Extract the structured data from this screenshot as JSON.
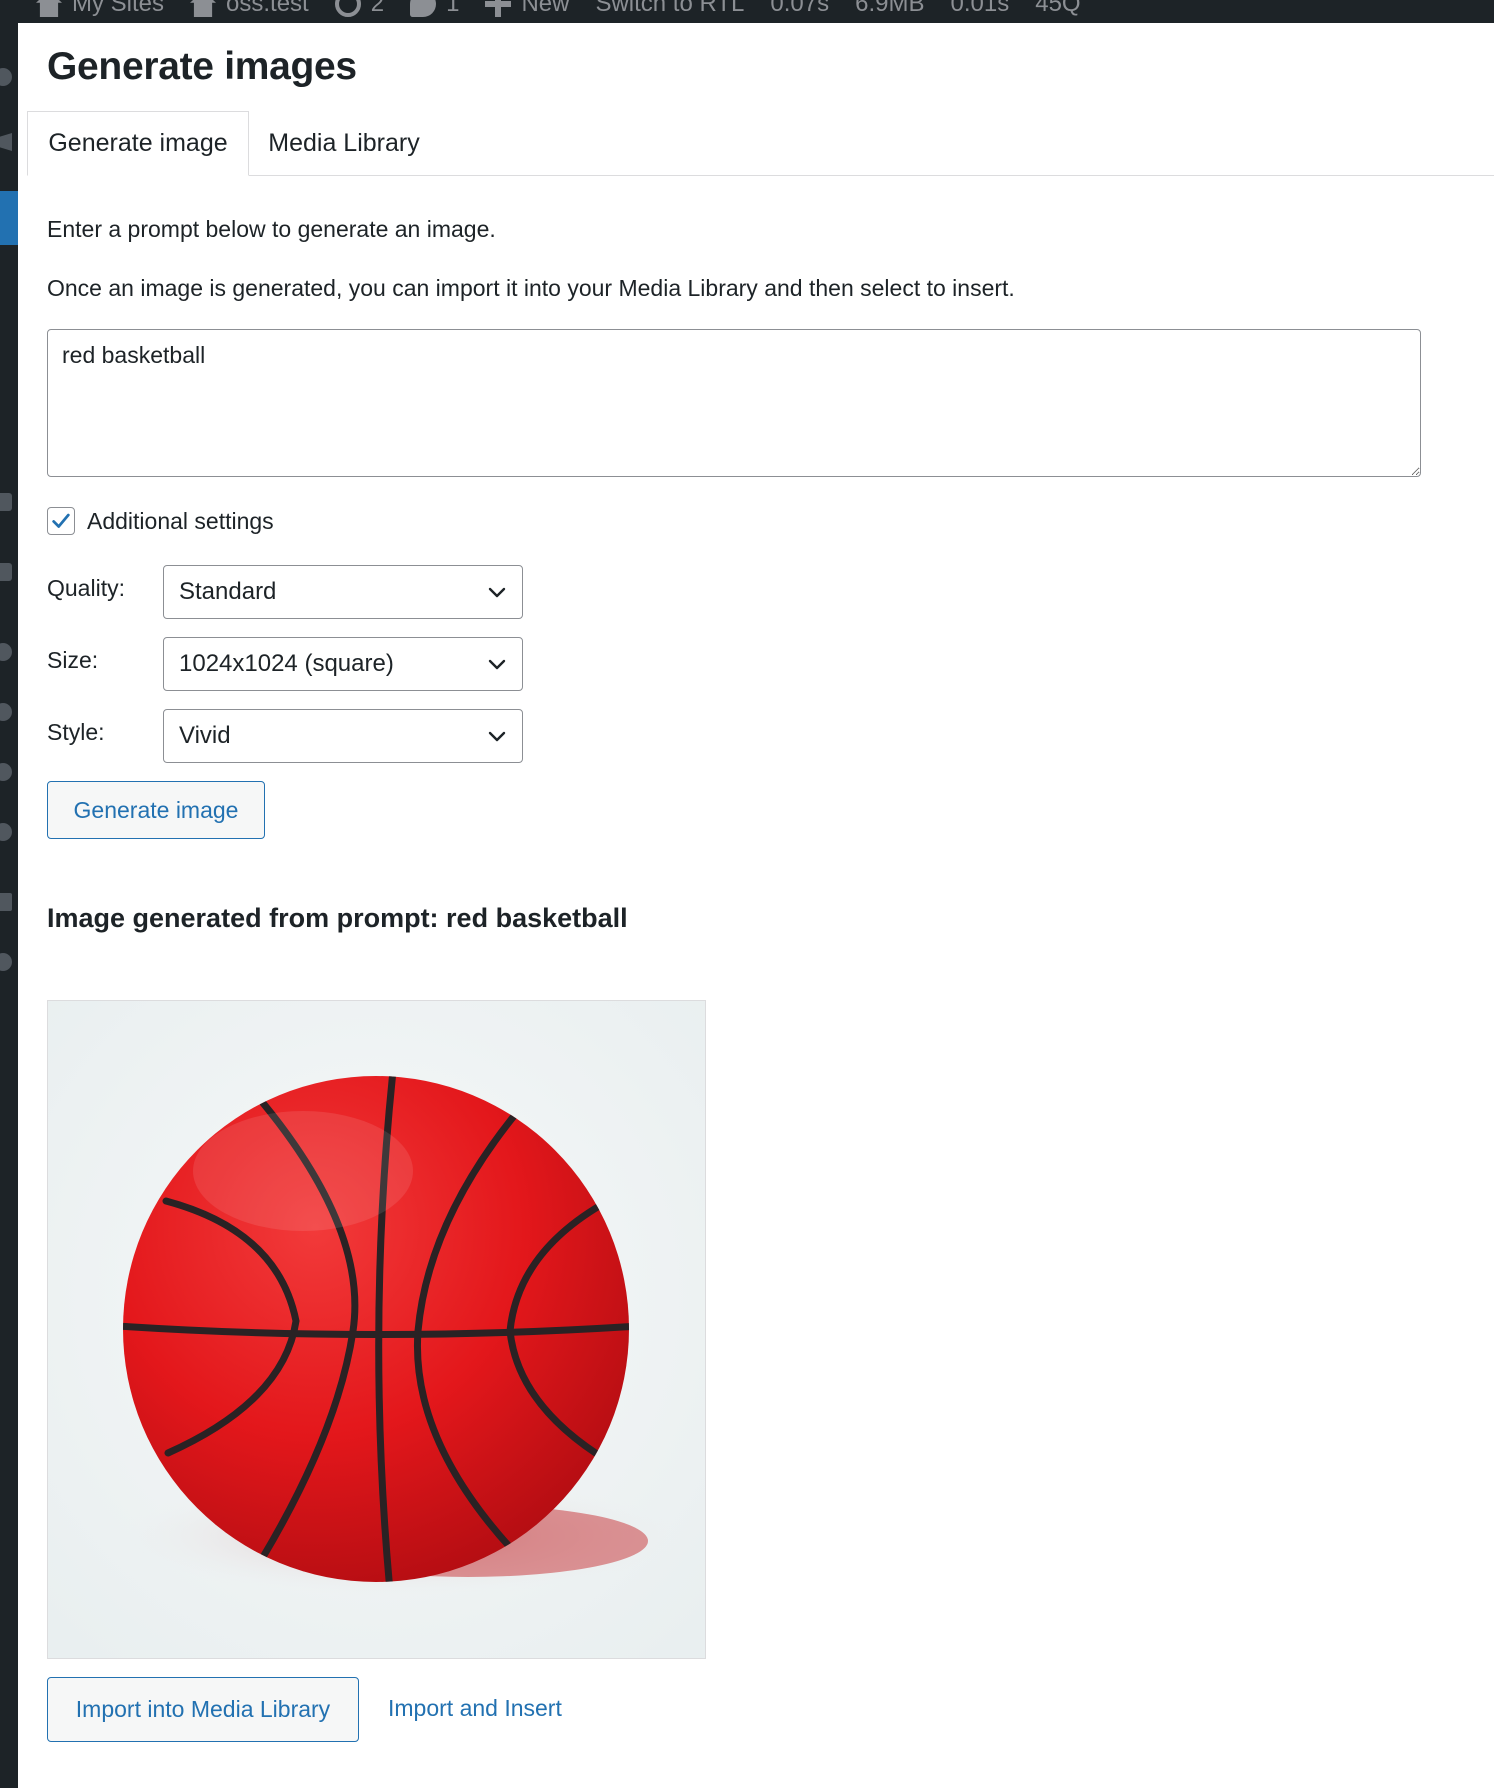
{
  "admin_bar": {
    "items": [
      {
        "icon": "my-sites-icon",
        "label": "My Sites"
      },
      {
        "icon": "home-icon",
        "label": "oss.test"
      },
      {
        "icon": "updates-icon",
        "label": "2"
      },
      {
        "icon": "comments-icon",
        "label": "1"
      },
      {
        "icon": "plus-icon",
        "label": "New"
      },
      {
        "icon": "",
        "label": "Switch to RTL"
      },
      {
        "icon": "",
        "label": "0.07s"
      },
      {
        "icon": "",
        "label": "6.9MB"
      },
      {
        "icon": "",
        "label": "0.01s"
      },
      {
        "icon": "",
        "label": "45Q"
      }
    ]
  },
  "page": {
    "title": "Generate images"
  },
  "tabs": {
    "generate": "Generate image",
    "library": "Media Library"
  },
  "instructions": {
    "line1": "Enter a prompt below to generate an image.",
    "line2": "Once an image is generated, you can import it into your Media Library and then select to insert."
  },
  "prompt": {
    "value": "red basketball"
  },
  "additional_settings": {
    "label": "Additional settings",
    "checked": true
  },
  "settings": {
    "quality_label": "Quality:",
    "quality_value": "Standard",
    "size_label": "Size:",
    "size_value": "1024x1024 (square)",
    "style_label": "Style:",
    "style_value": "Vivid"
  },
  "actions": {
    "generate": "Generate image",
    "import": "Import into Media Library",
    "import_insert": "Import and Insert"
  },
  "result": {
    "heading": "Image generated from prompt: red basketball"
  },
  "colors": {
    "accent": "#2271b1",
    "admin_dark": "#1d2327",
    "ball_red": "#e3171b"
  }
}
